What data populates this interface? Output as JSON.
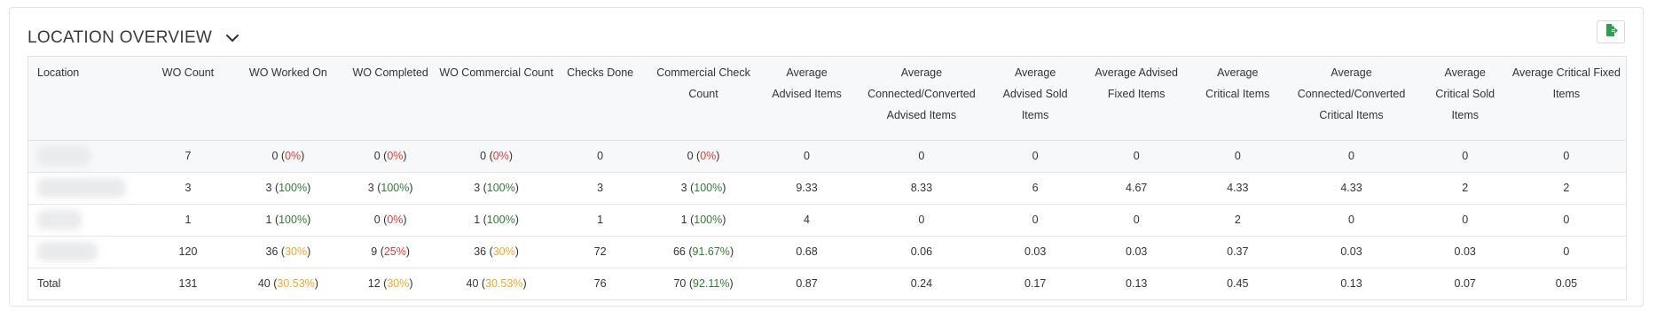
{
  "header": {
    "title": "LOCATION OVERVIEW"
  },
  "icons": {
    "toggle": "chevron-down-icon",
    "export": "export-file-icon"
  },
  "colors": {
    "red": "#e53935",
    "green": "#2e7d32",
    "orange": "#f5a623",
    "export_icon": "#2e9e4f"
  },
  "table": {
    "columns": [
      "Location",
      "WO Count",
      "WO Worked On",
      "WO Completed",
      "WO Commercial Count",
      "Checks Done",
      "Commercial Check Count",
      "Average Advised Items",
      "Average Connected/Converted Advised Items",
      "Average Advised Sold Items",
      "Average Advised Fixed Items",
      "Average Critical Items",
      "Average Connected/Converted Critical Items",
      "Average Critical Sold Items",
      "Average Critical Fixed Items"
    ],
    "rows": [
      {
        "location": "",
        "wo_count": "7",
        "wo_worked_on": {
          "value": "0",
          "pct": "0%",
          "status": "red"
        },
        "wo_completed": {
          "value": "0",
          "pct": "0%",
          "status": "red"
        },
        "wo_commercial_count": {
          "value": "0",
          "pct": "0%",
          "status": "red"
        },
        "checks_done": "0",
        "commercial_check_count": {
          "value": "0",
          "pct": "0%",
          "status": "red"
        },
        "avg_advised_items": "0",
        "avg_connected_advised": "0",
        "avg_advised_sold": "0",
        "avg_advised_fixed": "0",
        "avg_critical_items": "0",
        "avg_connected_critical": "0",
        "avg_critical_sold": "0",
        "avg_critical_fixed": "0"
      },
      {
        "location": "",
        "wo_count": "3",
        "wo_worked_on": {
          "value": "3",
          "pct": "100%",
          "status": "green"
        },
        "wo_completed": {
          "value": "3",
          "pct": "100%",
          "status": "green"
        },
        "wo_commercial_count": {
          "value": "3",
          "pct": "100%",
          "status": "green"
        },
        "checks_done": "3",
        "commercial_check_count": {
          "value": "3",
          "pct": "100%",
          "status": "green"
        },
        "avg_advised_items": "9.33",
        "avg_connected_advised": "8.33",
        "avg_advised_sold": "6",
        "avg_advised_fixed": "4.67",
        "avg_critical_items": "4.33",
        "avg_connected_critical": "4.33",
        "avg_critical_sold": "2",
        "avg_critical_fixed": "2"
      },
      {
        "location": "",
        "wo_count": "1",
        "wo_worked_on": {
          "value": "1",
          "pct": "100%",
          "status": "green"
        },
        "wo_completed": {
          "value": "0",
          "pct": "0%",
          "status": "red"
        },
        "wo_commercial_count": {
          "value": "1",
          "pct": "100%",
          "status": "green"
        },
        "checks_done": "1",
        "commercial_check_count": {
          "value": "1",
          "pct": "100%",
          "status": "green"
        },
        "avg_advised_items": "4",
        "avg_connected_advised": "0",
        "avg_advised_sold": "0",
        "avg_advised_fixed": "0",
        "avg_critical_items": "2",
        "avg_connected_critical": "0",
        "avg_critical_sold": "0",
        "avg_critical_fixed": "0"
      },
      {
        "location": "",
        "wo_count": "120",
        "wo_worked_on": {
          "value": "36",
          "pct": "30%",
          "status": "orange"
        },
        "wo_completed": {
          "value": "9",
          "pct": "25%",
          "status": "red"
        },
        "wo_commercial_count": {
          "value": "36",
          "pct": "30%",
          "status": "orange"
        },
        "checks_done": "72",
        "commercial_check_count": {
          "value": "66",
          "pct": "91.67%",
          "status": "green"
        },
        "avg_advised_items": "0.68",
        "avg_connected_advised": "0.06",
        "avg_advised_sold": "0.03",
        "avg_advised_fixed": "0.03",
        "avg_critical_items": "0.37",
        "avg_connected_critical": "0.03",
        "avg_critical_sold": "0.03",
        "avg_critical_fixed": "0"
      },
      {
        "location": "Total",
        "wo_count": "131",
        "wo_worked_on": {
          "value": "40",
          "pct": "30.53%",
          "status": "orange"
        },
        "wo_completed": {
          "value": "12",
          "pct": "30%",
          "status": "orange"
        },
        "wo_commercial_count": {
          "value": "40",
          "pct": "30.53%",
          "status": "orange"
        },
        "checks_done": "76",
        "commercial_check_count": {
          "value": "70",
          "pct": "92.11%",
          "status": "green"
        },
        "avg_advised_items": "0.87",
        "avg_connected_advised": "0.24",
        "avg_advised_sold": "0.17",
        "avg_advised_fixed": "0.13",
        "avg_critical_items": "0.45",
        "avg_connected_critical": "0.13",
        "avg_critical_sold": "0.07",
        "avg_critical_fixed": "0.05"
      }
    ]
  }
}
